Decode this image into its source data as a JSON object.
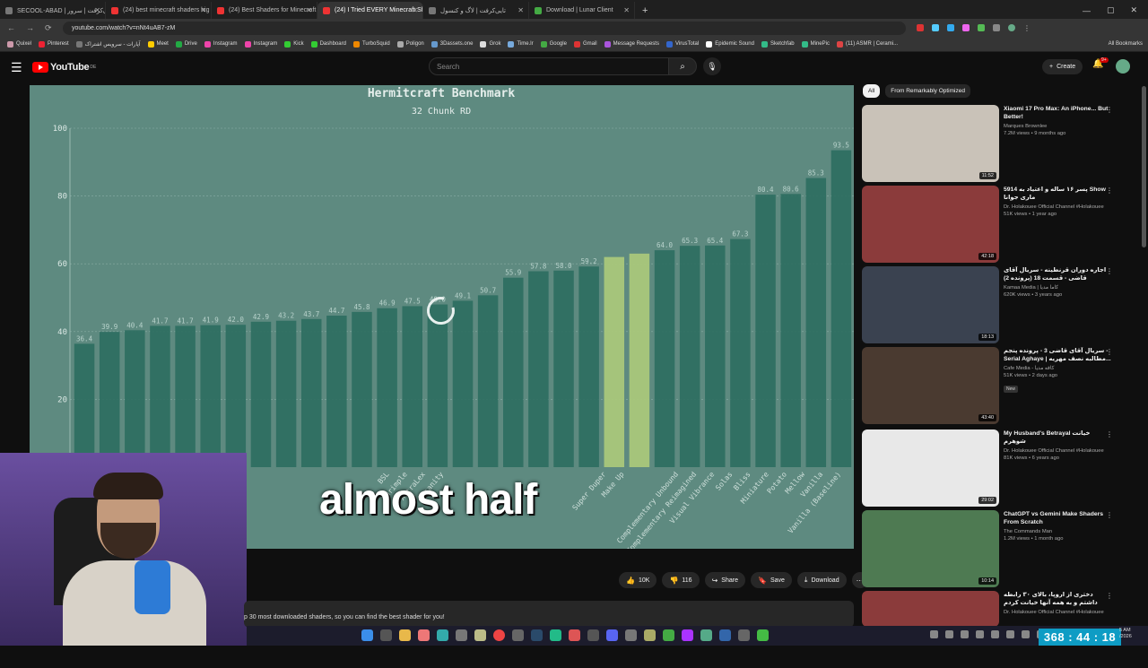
{
  "browser": {
    "tabs": [
      {
        "title": "SECOOL-ABAD | تایی‌کرفت | سرور",
        "icon": "b"
      },
      {
        "title": "(24) best minecraft shaders hig",
        "icon": "r"
      },
      {
        "title": "(24) Best Shaders for Minecraft",
        "icon": "r"
      },
      {
        "title": "(24) I Tried EVERY Minecraft Sh",
        "icon": "r",
        "active": true
      },
      {
        "title": "تایی‌کرفت | لاگ و کنسول",
        "icon": "b"
      },
      {
        "title": "Download | Lunar Client",
        "icon": "g"
      }
    ],
    "url": "youtube.com/watch?v=nNt4uAB7-zM",
    "bookmarks": [
      "Quixel",
      "Pinterest",
      "آپارات - سرویس اشتراک",
      "Meet",
      "Drive",
      "Instagram",
      "Instagram",
      "Kick",
      "Dashboard",
      "TurboSquid",
      "Poligon",
      "3Dassets.one",
      "Grok",
      "Time.lr",
      "Google",
      "Gmail",
      "Message Requests",
      "VirusTotal",
      "Epidemic Sound",
      "Sketchfab",
      "MinePic",
      "(11) ASMR | Cerami..."
    ],
    "all_bookmarks": "All Bookmarks"
  },
  "youtube": {
    "logo": "YouTube",
    "logo_region": "DE",
    "search_placeholder": "Search",
    "create": "Create",
    "notifications": "9+"
  },
  "video": {
    "caption": "almost half",
    "chart_data": {
      "type": "bar",
      "title": "Hermitcraft Benchmark",
      "subtitle": "32 Chunk RD",
      "ylim": [
        0,
        100
      ],
      "yticks": [
        20.0,
        40.0,
        60.0,
        80.0,
        100.0
      ],
      "values": [
        36.4,
        39.9,
        40.4,
        41.7,
        41.7,
        41.9,
        42.0,
        42.9,
        43.2,
        43.7,
        44.7,
        45.8,
        46.9,
        47.5,
        48.0,
        49.1,
        50.7,
        55.9,
        57.8,
        58.0,
        59.2,
        62.0,
        63.0,
        64.0,
        65.3,
        65.4,
        67.3,
        80.4,
        80.6,
        85.3,
        93.5
      ],
      "value_labels": [
        "36.4",
        "39.9",
        "40.4",
        "41.7",
        "41.7",
        "41.9",
        "42.0",
        "42.9",
        "43.2",
        "43.7",
        "44.7",
        "45.8",
        "46.9",
        "47.5",
        "48.0",
        "49.1",
        "50.7",
        "55.9",
        "57.8",
        "58.0",
        "59.2",
        "",
        "",
        "64.0",
        "65.3",
        "65.4",
        "67.3",
        "80.4",
        "80.6",
        "85.3",
        "93.5"
      ],
      "categories": [
        "",
        "",
        "",
        "",
        "",
        "",
        "",
        "BSL",
        "Shrimple",
        "AstraLex",
        "Insanity",
        "",
        "",
        "",
        "",
        "",
        "",
        "",
        "",
        "Super Duper",
        "Make Up",
        "",
        "",
        "Complementary Unbound",
        "Complementary Reimagined",
        "Visual Vibrance",
        "Solas",
        "Bliss",
        "Miniature",
        "Potato",
        "Mellow",
        "Vanilla",
        "Vanilla (Baseline)"
      ],
      "highlight_indices": [
        21,
        22
      ]
    }
  },
  "actions": {
    "like": "10K",
    "dislike": "116",
    "share": "Share",
    "save": "Save",
    "download": "Download"
  },
  "description": "p 30 most downloaded shaders, so you can find the best shader for you!",
  "sidebar": {
    "chips": [
      "All",
      "From Remarkably Optimized"
    ],
    "recommendations": [
      {
        "title": "Xiaomi 17 Pro Max: An iPhone... But Better!",
        "channel": "Marques Brownlee",
        "views": "7.2M views • 9 months ago",
        "duration": "11:52",
        "color": "#c9c2b8"
      },
      {
        "title": "پسر ۱۶ ساله و اعتیاد به 5914 Show ماری جوانا",
        "channel": "Dr. Holakouee Official Channel #Holakouee",
        "views": "51K views • 1 year ago",
        "duration": "42:18",
        "color": "#8b3b3b"
      },
      {
        "title": "اجاره دوران قرنطینه - سریال آقای قاضی - قسمت 18 (پرونده 2)",
        "channel": "Kamaa Media | کاما مدیا",
        "views": "620K views • 3 years ago",
        "duration": "18:13",
        "color": "#3a4250"
      },
      {
        "title": "سریال آقای قاضی 3 - پرونده پنجم - Serial Aghaye | مطالبه نصف مهریه...",
        "channel": "Cafe Media - کافه مدیا",
        "views": "51K views • 2 days ago",
        "duration": "43:40",
        "color": "#4a3a30",
        "badge": "New"
      },
      {
        "title": "My Husband's Betrayal خیانت شوهرم",
        "channel": "Dr. Holakouee Official Channel #Holakouee",
        "views": "81K views • 6 years ago",
        "duration": "29:02",
        "color": "#e8e8e8"
      },
      {
        "title": "ChatGPT vs Gemini Make Shaders From Scratch",
        "channel": "The Commands Man",
        "views": "1.2M views • 1 month ago",
        "duration": "10:14",
        "color": "#4e7a52"
      },
      {
        "title": "دختری از اروپا، بالای ۳۰ رابطه داشتم و به همه آنها خیانت کردم",
        "channel": "Dr. Holakouee Official Channel #Holakouee",
        "views": "",
        "duration": "",
        "color": "#8b3b3b"
      }
    ]
  },
  "overlay": {
    "timer": "368 : 44 : 18",
    "clock_time": "5 AM",
    "clock_date": "/2026"
  }
}
